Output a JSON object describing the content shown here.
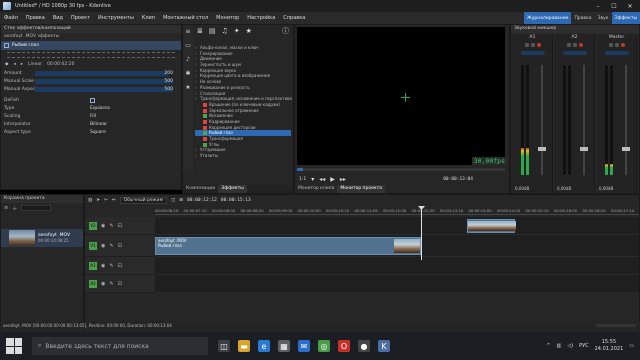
{
  "window": {
    "title": "Untitled* / HD 1080p 30 fps - Kdenlive"
  },
  "menu": [
    "Файл",
    "Правка",
    "Вид",
    "Проект",
    "Инструменты",
    "Клип",
    "Монтажный стол",
    "Монитор",
    "Настройка",
    "Справка"
  ],
  "layouts": [
    "Журналирование",
    "Правка",
    "Звук",
    "Эффекты"
  ],
  "effects_panel": {
    "title": "Стек эффектов/композиций",
    "clip": "aerofoyt .MOV эффекты",
    "effect_name": "Рыбий глаз",
    "mode": "Linear",
    "timecode": "00:00:02:20",
    "params": [
      {
        "label": "Amount",
        "value": "200",
        "fill": 0.96
      },
      {
        "label": "Manual Scale",
        "value": "500",
        "fill": 0.9
      },
      {
        "label": "Manual Aspect",
        "value": "500",
        "fill": 0.9
      }
    ],
    "options": [
      {
        "label": "DeFish",
        "value": ""
      },
      {
        "label": "Type",
        "value": "Equiarea"
      },
      {
        "label": "Scaling",
        "value": "Fill"
      },
      {
        "label": "Interpolator",
        "value": "Bilinear"
      },
      {
        "label": "Aspect type",
        "value": "Square"
      }
    ]
  },
  "effects_list": {
    "items": [
      {
        "label": "Альфа-канал, маски и ключ",
        "level": 0,
        "sel": false,
        "swatch": ""
      },
      {
        "label": "Генерирование",
        "level": 0,
        "sel": false,
        "swatch": ""
      },
      {
        "label": "Движение",
        "level": 0,
        "sel": false,
        "swatch": ""
      },
      {
        "label": "Зернистость и шум",
        "level": 0,
        "sel": false,
        "swatch": ""
      },
      {
        "label": "Коррекция звука",
        "level": 0,
        "sel": false,
        "swatch": ""
      },
      {
        "label": "Коррекция цвета и изображения",
        "level": 0,
        "sel": false,
        "swatch": ""
      },
      {
        "label": "На основе",
        "level": 0,
        "sel": false,
        "swatch": ""
      },
      {
        "label": "Размывание и резкость",
        "level": 0,
        "sel": false,
        "swatch": ""
      },
      {
        "label": "Стилизация",
        "level": 0,
        "sel": false,
        "swatch": ""
      },
      {
        "label": "Трансформация, искажение и перспектива",
        "level": 0,
        "sel": false,
        "swatch": ""
      },
      {
        "label": "Вращение (по ключевым кадрам)",
        "level": 1,
        "sel": false,
        "swatch": "#d44"
      },
      {
        "label": "Зеркальное отражение",
        "level": 1,
        "sel": false,
        "swatch": "#d44"
      },
      {
        "label": "Искажение",
        "level": 1,
        "sel": false,
        "swatch": "#4a4"
      },
      {
        "label": "Кадрирование",
        "level": 1,
        "sel": false,
        "swatch": "#d44"
      },
      {
        "label": "Коррекция дисторсии",
        "level": 1,
        "sel": false,
        "swatch": "#d44"
      },
      {
        "label": "Рыбий глаз",
        "level": 1,
        "sel": true,
        "swatch": "#4a4"
      },
      {
        "label": "Трансформация",
        "level": 1,
        "sel": false,
        "swatch": "#d44"
      },
      {
        "label": "Углы",
        "level": 1,
        "sel": false,
        "swatch": "#4a4"
      },
      {
        "label": "Устаревшие",
        "level": 0,
        "sel": false,
        "swatch": ""
      },
      {
        "label": "Утилиты",
        "level": 0,
        "sel": false,
        "swatch": ""
      }
    ],
    "tabs": [
      "Композиции",
      "Эффекты"
    ]
  },
  "monitor": {
    "fps": "30,00fps",
    "zoom": "1:1",
    "timecode": "00:00:13:04",
    "progress": 0.03,
    "tabs": [
      "Монитор клипа",
      "Монитор проекта"
    ]
  },
  "mixer": {
    "title": "Звуковой микшер",
    "channels": [
      {
        "name": "A1",
        "db": "0,00dB",
        "level": 0.25,
        "fader": 0.22
      },
      {
        "name": "A2",
        "db": "0,00dB",
        "level": 0.0,
        "fader": 0.22
      },
      {
        "name": "Master",
        "db": "0,00dB",
        "level": 0.1,
        "fader": 0.22
      }
    ]
  },
  "bin": {
    "title": "Корзина проекта",
    "clip_name": "aerofoyt .MOV",
    "clip_duration": "00:00:14:08:25"
  },
  "timeline": {
    "mode": "Обычный режим",
    "time": "00:00:12:12",
    "duration": "00:00:15:13",
    "ruler": [
      "00:00:06:19",
      "00:00:07:10",
      "00:00:08:00",
      "00:00:08:20",
      "00:00:09:09",
      "00:00:10:00",
      "00:00:10:20",
      "00:00:11:09",
      "00:00:12:00",
      "00:00:12:20",
      "00:00:13:10",
      "00:00:14:00",
      "00:00:14:20",
      "00:00:15:10",
      "00:00:16:00",
      "00:00:16:20",
      "00:00:17:10"
    ],
    "tracks": [
      "V2",
      "V1",
      "A1",
      "A2"
    ],
    "clip_v1_name": "aerofoyt .MOV",
    "clip_v1_fx": "Рыбий глаз"
  },
  "status": "aerofoyt .MOV [00:00:00:00-00:00:13:05], Position: 00:00:00, Duration: 00:00:13:04",
  "taskbar": {
    "search_placeholder": "Введите здесь текст для поиска",
    "lang": "РУС",
    "time": "15:55",
    "date": "24.01.2021"
  },
  "colors": {
    "accent": "#2e6ab3",
    "clip": "#52738f",
    "track_tag": "#4aa04a"
  }
}
